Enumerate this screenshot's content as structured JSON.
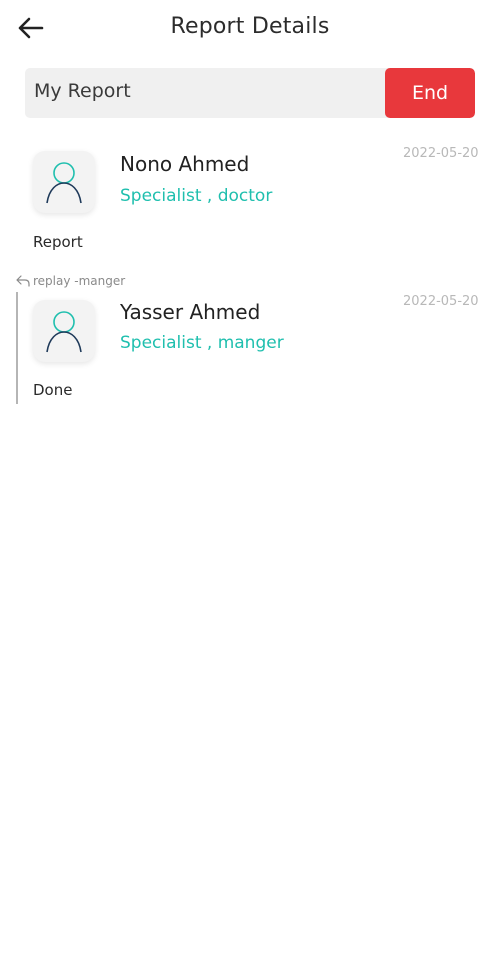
{
  "header": {
    "title": "Report Details",
    "back_icon": "arrow-left-icon"
  },
  "report": {
    "name": "My Report",
    "end_label": "End",
    "end_color": "#e8383c"
  },
  "entries": [
    {
      "name": "Nono Ahmed",
      "role": "Specialist , doctor",
      "date": "2022-05-20",
      "text": "Report",
      "avatar_icon": "user-avatar-icon"
    }
  ],
  "reply": {
    "label": "replay -manger",
    "icon": "reply-icon",
    "entry": {
      "name": "Yasser Ahmed",
      "role": "Specialist , manger",
      "date": "2022-05-20",
      "text": "Done",
      "avatar_icon": "user-avatar-icon"
    }
  },
  "colors": {
    "accent": "#1fbfae",
    "danger": "#e8383c",
    "avatar_head": "#1fbfae",
    "avatar_body": "#1f3a5a"
  }
}
